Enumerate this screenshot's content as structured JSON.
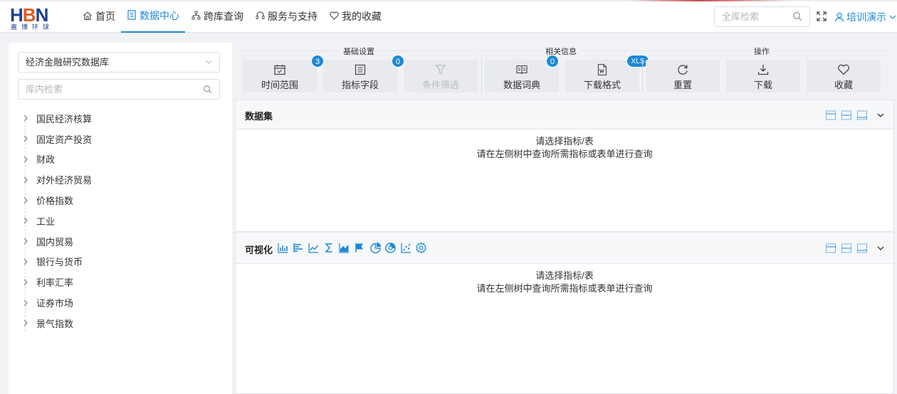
{
  "brand": {
    "logo_main_left": "H",
    "logo_main_mid": "B",
    "logo_main_right": "N",
    "logo_sub": "嘉博环球"
  },
  "nav": {
    "items": [
      {
        "label": "首页",
        "icon": "home-icon",
        "active": false
      },
      {
        "label": "数据中心",
        "icon": "list-icon",
        "active": true
      },
      {
        "label": "跨库查询",
        "icon": "sitemap-icon",
        "active": false
      },
      {
        "label": "服务与支持",
        "icon": "headset-icon",
        "active": false
      },
      {
        "label": "我的收藏",
        "icon": "heart-icon",
        "active": false
      }
    ],
    "search_placeholder": "全库检索",
    "user_name": "培训演示"
  },
  "sidebar": {
    "database_select": "经济金融研究数据库",
    "search_placeholder": "库内检索",
    "tree": [
      "国民经济核算",
      "固定资产投资",
      "财政",
      "对外经济贸易",
      "价格指数",
      "工业",
      "国内贸易",
      "银行与货币",
      "利率汇率",
      "证券市场",
      "景气指数"
    ]
  },
  "toolbar": {
    "groups": {
      "basic": "基础设置",
      "related": "相关信息",
      "ops": "操作"
    },
    "buttons": {
      "time_range": {
        "label": "时间范围",
        "badge": "3"
      },
      "indicator_fields": {
        "label": "指标字段",
        "badge": "0"
      },
      "condition_filter": {
        "label": "条件筛选"
      },
      "data_dictionary": {
        "label": "数据词典",
        "badge": "0"
      },
      "download_format": {
        "label": "下载格式",
        "badge": "XLS"
      },
      "reset": {
        "label": "重置"
      },
      "download": {
        "label": "下载"
      },
      "favorite": {
        "label": "收藏"
      }
    }
  },
  "dataset_panel": {
    "title": "数据集",
    "message_line1": "请选择指标/表",
    "message_line2": "请在左侧树中查询所需指标或表单进行查询"
  },
  "viz_panel": {
    "title": "可视化",
    "message_line1": "请选择指标/表",
    "message_line2": "请在左侧树中查询所需指标或表单进行查询",
    "chart_icons": [
      "bar-chart-icon",
      "horizontal-bar-icon",
      "line-chart-icon",
      "sum-icon",
      "area-chart-icon",
      "flag-icon",
      "pie-chart-icon",
      "ring-chart-icon",
      "scatter-chart-icon",
      "settings-icon"
    ]
  },
  "colors": {
    "accent": "#1c89d6",
    "background": "#f0f2f5",
    "button_bg": "#e8eaee",
    "brand_blue": "#1f3f8f",
    "brand_orange": "#e25a1c"
  }
}
